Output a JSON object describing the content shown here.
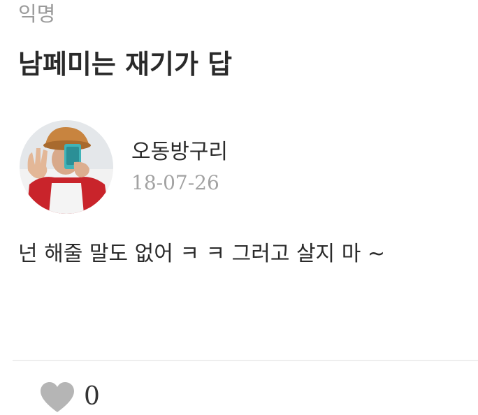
{
  "post": {
    "category": "익명",
    "title": "남페미는 재기가 답",
    "body": "넌 해줄 말도 없어 ㅋ ㅋ 그러고 살지 마 ~"
  },
  "author": {
    "name": "오동방구리",
    "date": "18-07-26"
  },
  "reactions": {
    "like_icon": "heart-icon",
    "like_count": "0"
  },
  "colors": {
    "muted_text": "#9a9a9a",
    "heart": "#b5b5b5",
    "divider": "#eeeeee"
  }
}
